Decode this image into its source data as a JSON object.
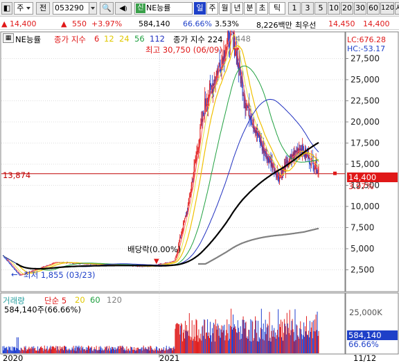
{
  "toolbar": {
    "market": "주",
    "prev_label": "전",
    "symbol_code": "053290",
    "symbol_badge": "신",
    "symbol_name": "NE능률",
    "periods": [
      "일",
      "주",
      "월",
      "년",
      "분",
      "초",
      "틱"
    ],
    "active_period": "일",
    "intervals": [
      "1",
      "3",
      "5",
      "10",
      "20",
      "30",
      "60",
      "120"
    ],
    "overflow_label": "시"
  },
  "quote": {
    "price": "14,400",
    "change": "550",
    "change_pct": "+3.97%",
    "volume": "584,140",
    "volume_ratio": "66.66%",
    "turnover_rate": "3.53%",
    "trade_value": "8,226백만",
    "best_ask_label": "최우선",
    "ask": "14,450",
    "bid": "14,400"
  },
  "legend": {
    "stock_tag": "NE능률",
    "price_ma_label": "종가 지수",
    "price_ma_periods": [
      "6",
      "12",
      "24",
      "56",
      "112"
    ],
    "long_ma_label": "종가 지수 224",
    "long_ma_period": "448",
    "volume_label": "거래량",
    "volume_ma_label": "단순 5",
    "volume_ma_periods": [
      "20",
      "60",
      "120"
    ],
    "volume_value": "584,140주(66.66%)"
  },
  "annotations": {
    "high": "최고 30,750 (06/09)",
    "low": "최저 1,855 (03/23)",
    "ex_dividend": "배당락(0.00%)",
    "lc": "LC:676.28",
    "hc": "HC:-53.17",
    "ref_level": "13,874",
    "current_price": "14,400",
    "current_pct": "3.97%",
    "volume_current": "584,140",
    "volume_pct": "66.66%"
  },
  "colors": {
    "candle_up": "#e02020",
    "candle_down": "#1f3fd0",
    "ma6": "#ff6060",
    "ma12": "#e8e040",
    "ma24": "#f0c000",
    "ma56": "#20a040",
    "ma112": "#2030c0",
    "ma224": "#000000",
    "ma448": "#808080",
    "accent_blue": "#1e40c8"
  },
  "chart_data": {
    "type": "candlestick",
    "series_name": "NE능률",
    "ylim": [
      0,
      30000
    ],
    "y_ticks": [
      "2,500",
      "5,000",
      "7,500",
      "10,000",
      "12,500",
      "15,000",
      "17,500",
      "20,000",
      "22,500",
      "25,000",
      "27,500"
    ],
    "x_ticks": [
      "2020",
      "2021",
      "11/12"
    ],
    "volume_tick": "25,000K",
    "approx_close_path": [
      {
        "t": "2020-01",
        "close": 4200
      },
      {
        "t": "2020-03",
        "close": 1855
      },
      {
        "t": "2020-06",
        "close": 3400
      },
      {
        "t": "2020-12",
        "close": 2900
      },
      {
        "t": "2021-02",
        "close": 3500
      },
      {
        "t": "2021-03",
        "close": 10000
      },
      {
        "t": "2021-04",
        "close": 22000
      },
      {
        "t": "2021-06",
        "close": 30750
      },
      {
        "t": "2021-07",
        "close": 22500
      },
      {
        "t": "2021-08",
        "close": 17000
      },
      {
        "t": "2021-09",
        "close": 13500
      },
      {
        "t": "2021-10",
        "close": 17000
      },
      {
        "t": "2021-11",
        "close": 14400
      }
    ],
    "ref_line": 13874,
    "last": 14400
  }
}
